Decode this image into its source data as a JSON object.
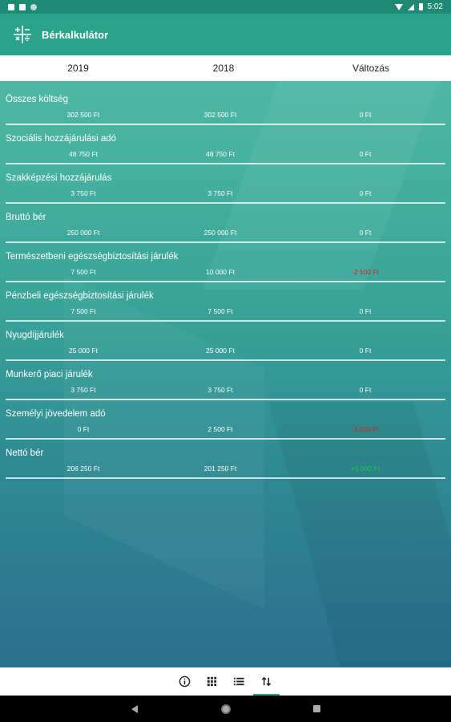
{
  "status": {
    "time": "5:02"
  },
  "app": {
    "title": "Bérkalkulátor",
    "menu_icon": "calculator-icon"
  },
  "tabs": [
    "2019",
    "2018",
    "Változás"
  ],
  "rows": [
    {
      "label": "Összes költség",
      "v2019": "302 500 Ft",
      "v2018": "302 500 Ft",
      "change": "0 Ft",
      "change_type": "zero"
    },
    {
      "label": "Szociális hozzájárulási adó",
      "v2019": "48 750 Ft",
      "v2018": "48 750 Ft",
      "change": "0 Ft",
      "change_type": "zero"
    },
    {
      "label": "Szakképzési hozzájárulás",
      "v2019": "3 750 Ft",
      "v2018": "3 750 Ft",
      "change": "0 Ft",
      "change_type": "zero"
    },
    {
      "label": "Bruttó bér",
      "v2019": "250 000 Ft",
      "v2018": "250 000 Ft",
      "change": "0 Ft",
      "change_type": "zero"
    },
    {
      "label": "Természetbeni egészségbiztosítási járulék",
      "v2019": "7 500 Ft",
      "v2018": "10 000 Ft",
      "change": "-2 500 Ft",
      "change_type": "negative"
    },
    {
      "label": "Pénzbeli egészségbiztosítási járulék",
      "v2019": "7 500 Ft",
      "v2018": "7 500 Ft",
      "change": "0 Ft",
      "change_type": "zero"
    },
    {
      "label": "Nyugdíjjárulék",
      "v2019": "25 000 Ft",
      "v2018": "25 000 Ft",
      "change": "0 Ft",
      "change_type": "zero"
    },
    {
      "label": "Munkerő piaci járulék",
      "v2019": "3 750 Ft",
      "v2018": "3 750 Ft",
      "change": "0 Ft",
      "change_type": "zero"
    },
    {
      "label": "Személyi jövedelem adó",
      "v2019": "0 Ft",
      "v2018": "2 500 Ft",
      "change": "-2 500 Ft",
      "change_type": "negative"
    },
    {
      "label": "Nettó bér",
      "v2019": "206 250 Ft",
      "v2018": "201 250 Ft",
      "change": "+5 000 Ft",
      "change_type": "positive"
    }
  ],
  "colors": {
    "accent": "#2aa38b",
    "negative": "#d42222",
    "positive": "#22cc44"
  },
  "bottom_nav": [
    "info-icon",
    "grid-icon",
    "list-icon",
    "compare-icon"
  ]
}
